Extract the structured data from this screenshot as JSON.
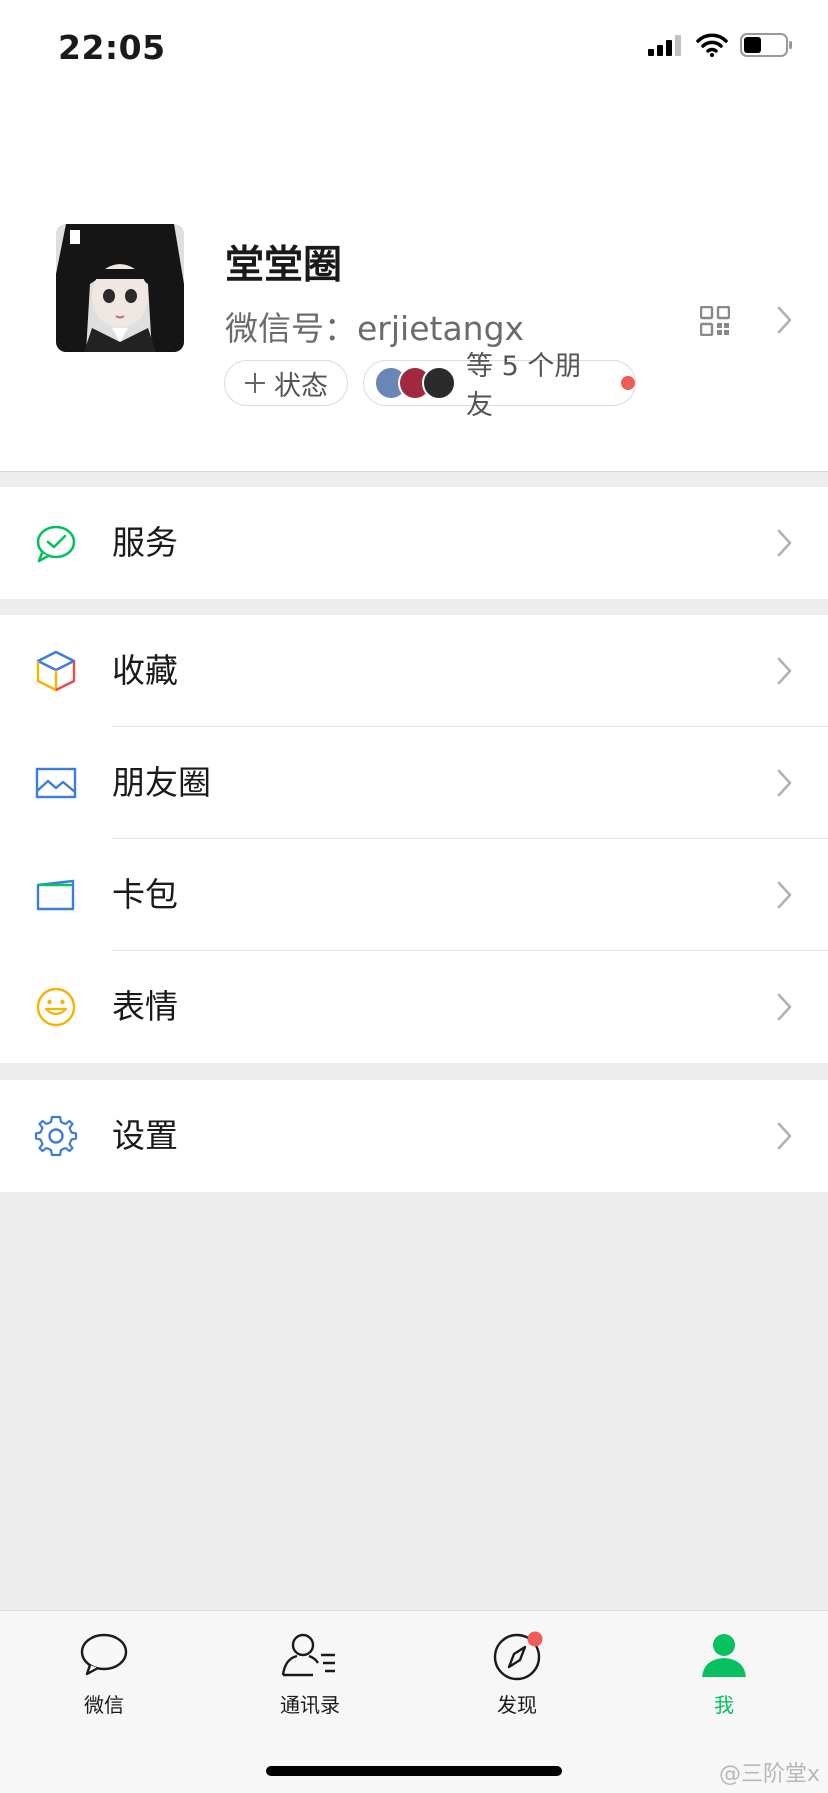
{
  "status_bar": {
    "time": "22:05"
  },
  "profile": {
    "nickname": "堂堂圈",
    "wechat_id_label": "微信号：",
    "wechat_id": "erjietangx",
    "status_button": "状态",
    "friends_text": "等 5 个朋友"
  },
  "menu": {
    "services": "服务",
    "favorites": "收藏",
    "moments": "朋友圈",
    "cards": "卡包",
    "stickers": "表情",
    "settings": "设置"
  },
  "tabbar": {
    "chats": "微信",
    "contacts": "通讯录",
    "discover": "发现",
    "me": "我",
    "active": "我"
  },
  "watermark": "@三阶堂x",
  "colors": {
    "accent": "#07c160",
    "badge": "#f05b57",
    "background": "#ededed"
  }
}
